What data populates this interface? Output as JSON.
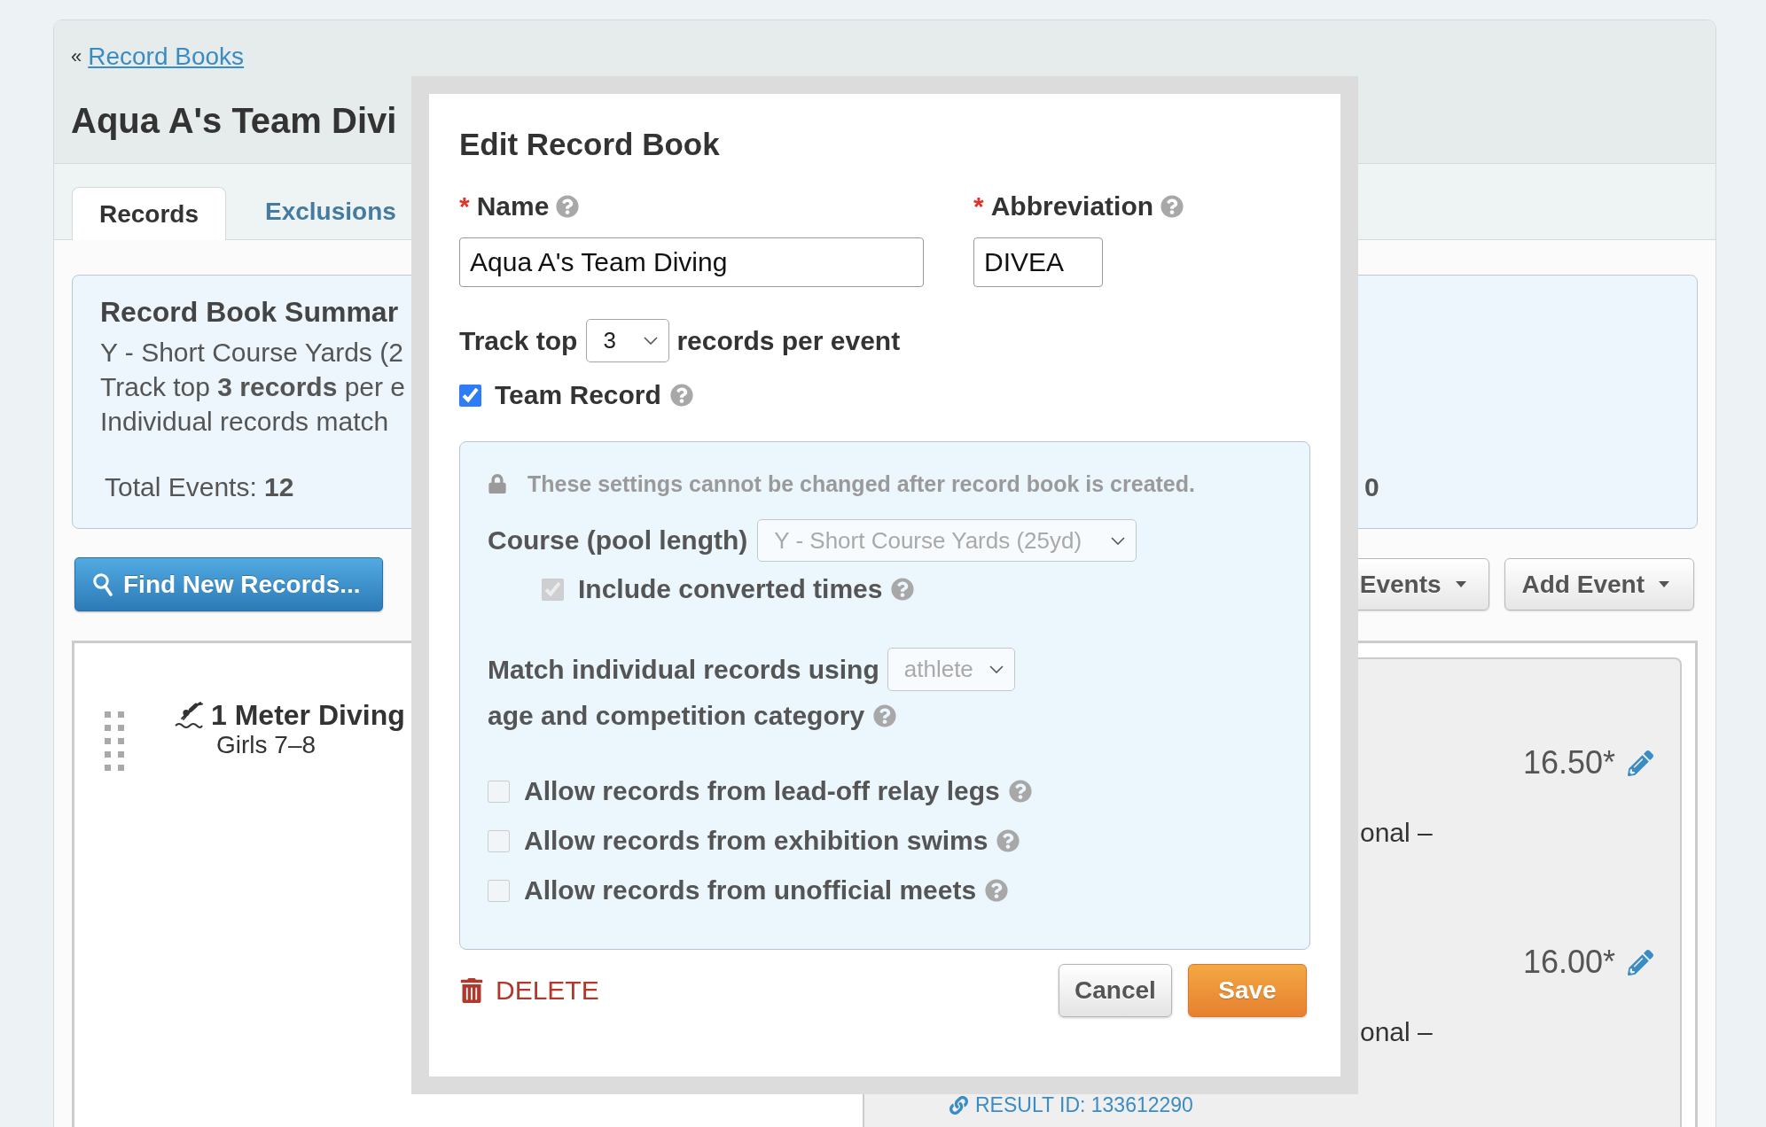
{
  "breadcrumb": {
    "prefix": "«",
    "link": "Record Books"
  },
  "title": "Aqua A's Team Divi",
  "tabs": [
    {
      "label": "Records",
      "selected": true
    },
    {
      "label": "Exclusions",
      "selected": false
    }
  ],
  "summary": {
    "heading": "Record Book Summar",
    "lines": [
      "Y - Short Course Yards (2",
      "Track top **3 records** per e",
      "Individual records match"
    ],
    "total": "Total Events: **12**",
    "column_2_value": "0"
  },
  "toolbar": {
    "find_button": "Find New Records...",
    "menus": [
      "Events",
      "Add Event"
    ]
  },
  "events": [
    {
      "title": "1 Meter Diving",
      "subtitle": "Girls 7–8"
    }
  ],
  "records": {
    "rows": [
      {
        "time": "16.50*",
        "detail": "onal –"
      },
      {
        "time": "16.00*",
        "detail": "onal –"
      }
    ],
    "result_link": "RESULT ID: 133612290"
  },
  "dialog": {
    "title": "Edit Record Book",
    "fields": [
      {
        "required_mark": "*",
        "label": "Name",
        "help": true,
        "value": "Aqua A's Team Diving"
      },
      {
        "required_mark": "*",
        "label": "Abbreviation",
        "help": true,
        "value": "DIVEA"
      }
    ],
    "track": {
      "label": "Track top",
      "value": "3",
      "disabled": false,
      "suffix": "records per event"
    },
    "team_record": {
      "label": "Team Record",
      "checked": true,
      "help": true
    },
    "locked": {
      "note": "These settings cannot be changed after record book is created.",
      "course": {
        "label": "Course (pool length)",
        "value": "Y - Short Course Yards (25yd)",
        "disabled": true
      },
      "include_converted": {
        "label": "Include converted times",
        "checked": true,
        "disabled": true,
        "help": true
      },
      "match": {
        "label": "Match individual records using",
        "value": "athlete",
        "disabled": true,
        "continuation": "age and competition category",
        "help": true
      },
      "options": [
        {
          "label": "Allow records from lead-off relay legs",
          "checked": false,
          "disabled": true,
          "help": true
        },
        {
          "label": "Allow records from exhibition swims",
          "checked": false,
          "disabled": true,
          "help": true
        },
        {
          "label": "Allow records from unofficial meets",
          "checked": false,
          "disabled": true,
          "help": true
        }
      ]
    },
    "delete": "DELETE",
    "buttons": [
      {
        "label": "Cancel",
        "kind": "secondary"
      },
      {
        "label": "Save",
        "kind": "primary"
      }
    ]
  }
}
